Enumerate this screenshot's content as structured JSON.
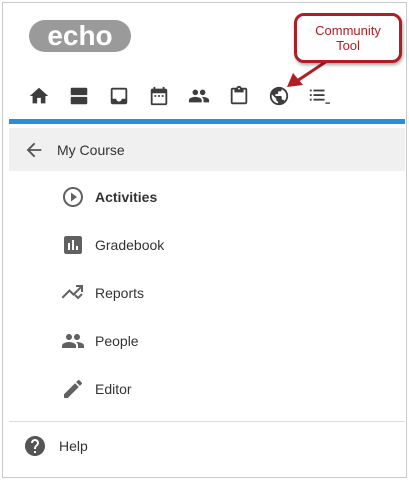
{
  "app": {
    "logo_text": "echo"
  },
  "toolbar": {
    "items": [
      {
        "icon": "home-icon"
      },
      {
        "icon": "sections-icon"
      },
      {
        "icon": "inbox-icon"
      },
      {
        "icon": "calendar-icon"
      },
      {
        "icon": "people-icon"
      },
      {
        "icon": "clipboard-icon"
      },
      {
        "icon": "globe-icon"
      },
      {
        "icon": "list-icon"
      }
    ]
  },
  "callout": {
    "line1": "Community",
    "line2": "Tool",
    "color": "#b01e23"
  },
  "accent_color": "#2f8ad8",
  "back": {
    "label": "My Course"
  },
  "menu": {
    "items": [
      {
        "label": "Activities",
        "icon": "play-circle-icon",
        "active": true
      },
      {
        "label": "Gradebook",
        "icon": "bar-chart-icon"
      },
      {
        "label": "Reports",
        "icon": "trend-icon"
      },
      {
        "label": "People",
        "icon": "people-icon"
      },
      {
        "label": "Editor",
        "icon": "pencil-icon"
      }
    ]
  },
  "help": {
    "label": "Help"
  }
}
